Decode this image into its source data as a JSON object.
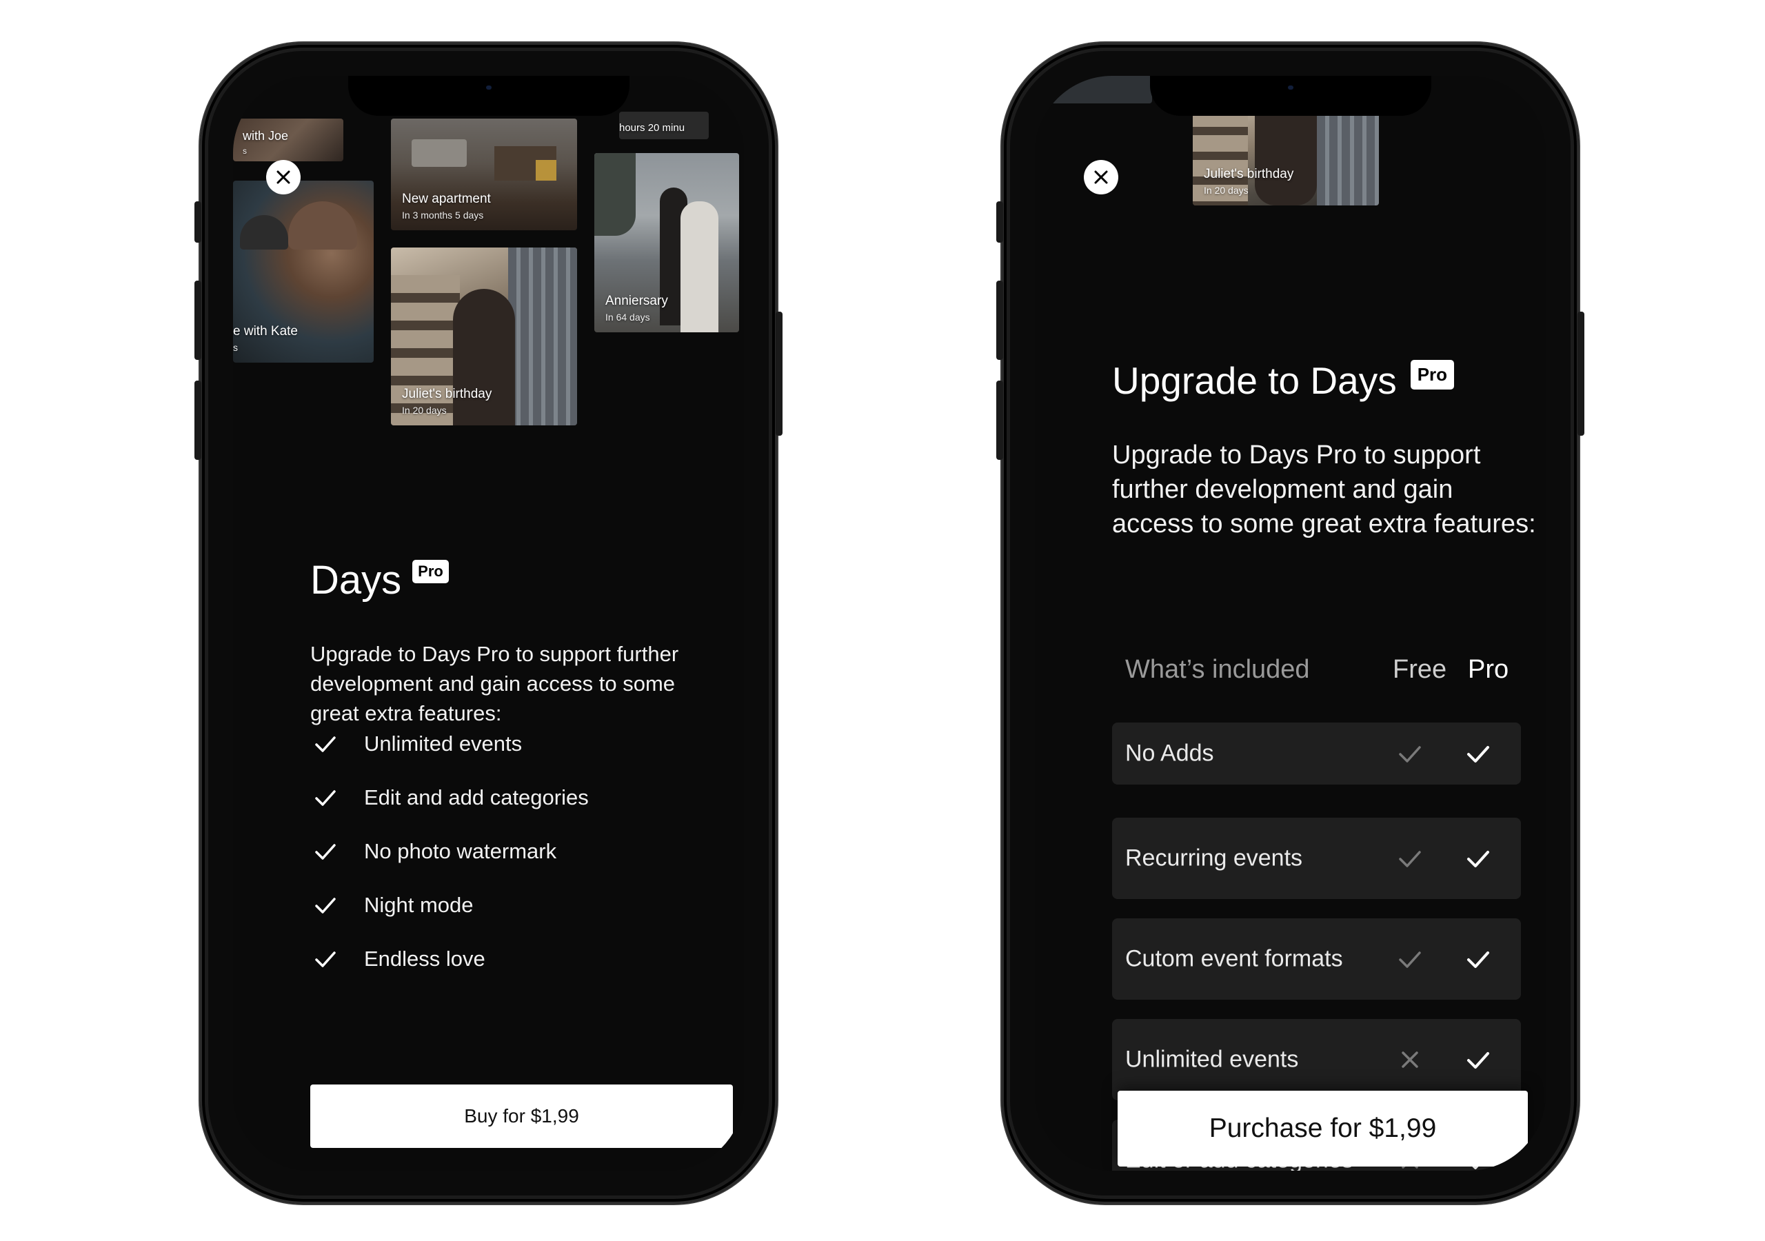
{
  "left_screen": {
    "photos": [
      {
        "title": "with Joe",
        "subtitle": "s"
      },
      {
        "title": "e with Kate",
        "subtitle": "s"
      },
      {
        "title": "New apartment",
        "subtitle": "In 3 months 5 days"
      },
      {
        "title": "Anniersary",
        "subtitle": "In 64 days"
      },
      {
        "title": "Juliet's birthday",
        "subtitle": "In 20 days"
      },
      {
        "title": "hours 20 minu",
        "subtitle": ""
      }
    ],
    "app_name": "Days",
    "pro_badge": "Pro",
    "description": "Upgrade to Days Pro to support further development and gain access to some great extra features:",
    "features": [
      "Unlimited events",
      "Edit and add categories",
      "No photo watermark",
      "Night mode",
      "Endless love"
    ],
    "buy_label": "Buy for $1,99"
  },
  "right_screen": {
    "photo": {
      "title": "Juliet's birthday",
      "subtitle": "In 20 days"
    },
    "title": "Upgrade to Days",
    "pro_badge": "Pro",
    "description": "Upgrade to Days Pro to support further development and gain access to some great extra features:",
    "table_header": {
      "included": "What’s included",
      "free": "Free",
      "pro": "Pro"
    },
    "rows": [
      {
        "label": "No Adds",
        "free": "check",
        "pro": "check"
      },
      {
        "label": "Recurring events",
        "free": "check",
        "pro": "check"
      },
      {
        "label": "Cutom event formats",
        "free": "check",
        "pro": "check"
      },
      {
        "label": "Unlimited events",
        "free": "cross",
        "pro": "check"
      },
      {
        "label": "Edit or add categories",
        "free": "cross",
        "pro": "check"
      }
    ],
    "purchase_label": "Purchase for $1,99"
  },
  "colors": {
    "background": "#0a0a0a",
    "accent": "#ffffff",
    "muted_check": "#7a7a7a",
    "row_bg": "#1f1f1f"
  }
}
